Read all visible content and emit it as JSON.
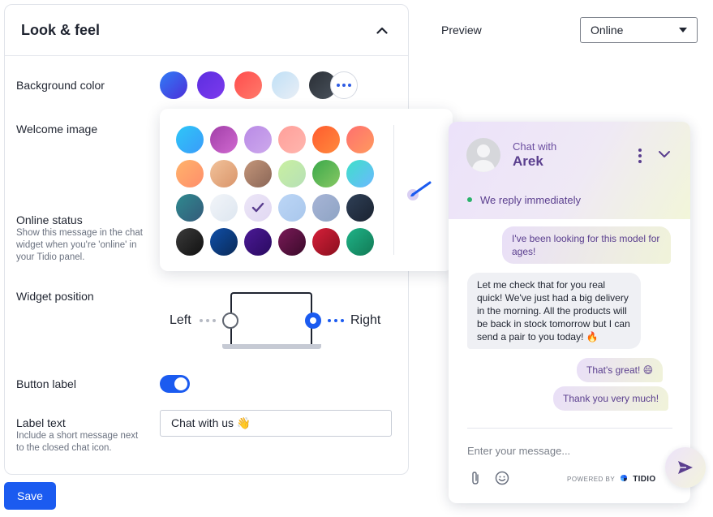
{
  "section": {
    "title": "Look & feel"
  },
  "background_color": {
    "label": "Background color",
    "swatches": [
      {
        "name": "blue",
        "from": "#2f7cf6",
        "to": "#4d2fd9"
      },
      {
        "name": "violet",
        "from": "#5c2ee0",
        "to": "#7c3aed"
      },
      {
        "name": "coral",
        "from": "#ff4d4d",
        "to": "#ff7a6b"
      },
      {
        "name": "light-blue",
        "from": "#bfe0f7",
        "to": "#e9eef5"
      },
      {
        "name": "charcoal",
        "from": "#2a2f36",
        "to": "#4a525c"
      }
    ]
  },
  "welcome_image": {
    "label": "Welcome image"
  },
  "online_status": {
    "label": "Online status",
    "help": "Show this message in the chat widget when you're 'online' in your Tidio panel."
  },
  "widget_position": {
    "label": "Widget position",
    "left": "Left",
    "right": "Right",
    "selected": "Right"
  },
  "button_label": {
    "label": "Button label",
    "enabled": true
  },
  "label_text": {
    "label": "Label text",
    "help": "Include a short message next to the closed chat icon.",
    "value": "Chat with us 👋"
  },
  "save_label": "Save",
  "preview": {
    "label": "Preview",
    "status_select": "Online"
  },
  "color_picker": {
    "rows": [
      [
        [
          "#2ec7f7",
          "#3a9bfa"
        ],
        [
          "#a13ea8",
          "#d06ad0"
        ],
        [
          "#b98ae6",
          "#cda9ec"
        ],
        [
          "#ff9f9a",
          "#ffb6ae"
        ],
        [
          "#ff5b2e",
          "#ff8a3d"
        ],
        [
          "#ff6f6f",
          "#ff9a5e"
        ]
      ],
      [
        [
          "#ffb36b",
          "#ff8e6b"
        ],
        [
          "#f2c29a",
          "#d9956b"
        ],
        [
          "#c4967a",
          "#8a6657"
        ],
        [
          "#c9f0a0",
          "#b6e0b7"
        ],
        [
          "#3aa84a",
          "#88c864"
        ],
        [
          "#3ee0c9",
          "#6bb8ff"
        ]
      ],
      [
        [
          "#2f8a8f",
          "#345a7a"
        ],
        [
          "#f2f5f9",
          "#dde6f0"
        ],
        [
          "#ece6f7",
          "#e1d8f2"
        ],
        [
          "#bcd6f6",
          "#a9c7ec"
        ],
        [
          "#a7b4d6",
          "#8ea4c4"
        ],
        [
          "#2f4057",
          "#1a2230"
        ]
      ],
      [
        [
          "#3b3b3b",
          "#111111"
        ],
        [
          "#0f4fa8",
          "#0a2a58"
        ],
        [
          "#4b1a96",
          "#2a0a60"
        ],
        [
          "#7a1a58",
          "#3a0a2a"
        ],
        [
          "#d6203a",
          "#8a0f1e"
        ],
        [
          "#1fb388",
          "#127a55"
        ]
      ]
    ],
    "selected": "2-2"
  },
  "chat": {
    "header_small": "Chat with",
    "agent": "Arek",
    "status": "We reply immediately",
    "messages": [
      {
        "from": "visitor",
        "text": "I've been looking for this model for ages!"
      },
      {
        "from": "agent",
        "text": "Let me check that for you real quick! We've just had a big delivery in the morning. All the products will be back in stock tomorrow but I can send a pair to you today! 🔥"
      },
      {
        "from": "visitor",
        "text": "That's great! 😄"
      },
      {
        "from": "visitor",
        "text": "Thank you very much!"
      }
    ],
    "composer_placeholder": "Enter your message...",
    "powered_by": "POWERED BY",
    "brand": "TIDIO"
  }
}
